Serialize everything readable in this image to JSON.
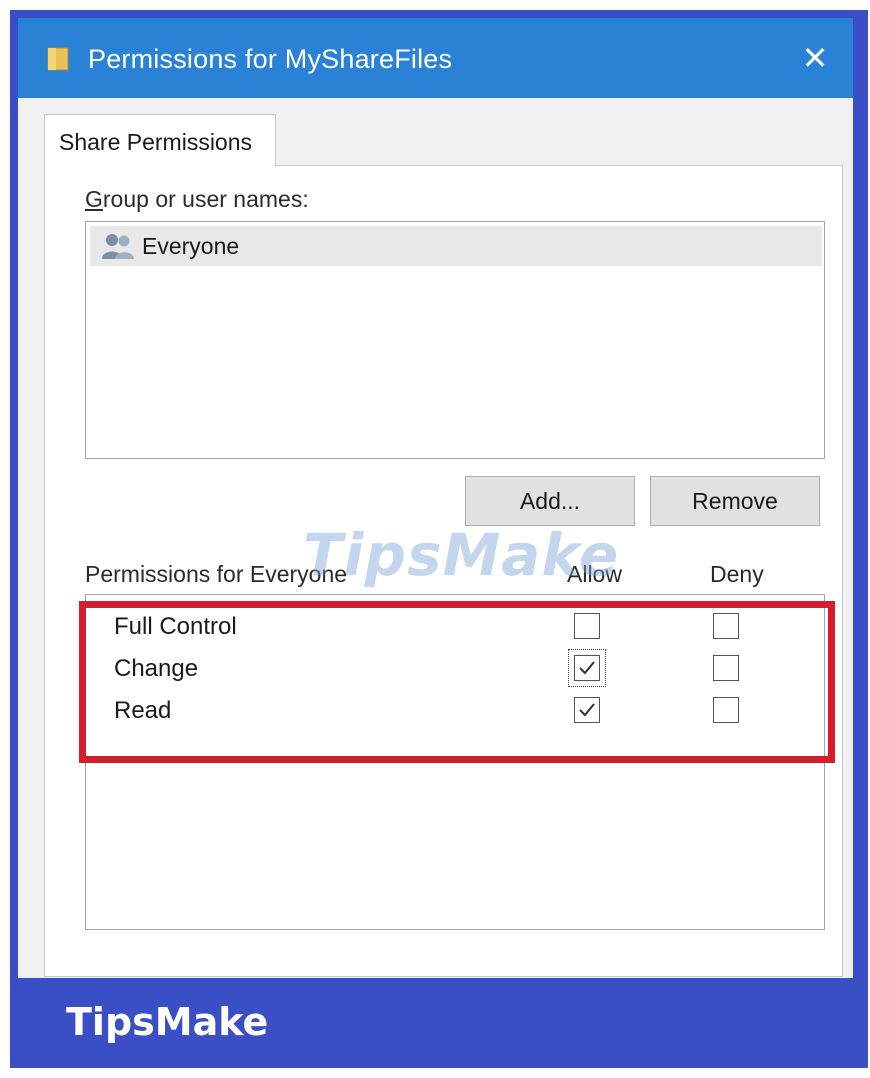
{
  "window": {
    "title": "Permissions for MyShareFiles",
    "close_symbol": "✕",
    "folder_icon": "folder-icon"
  },
  "tab": {
    "label": "Share Permissions"
  },
  "users": {
    "label": "Group or user names:",
    "items": [
      {
        "label": "Everyone",
        "icon": "users-icon"
      }
    ]
  },
  "buttons": {
    "add": "Add...",
    "remove": "Remove"
  },
  "permissions": {
    "header": "Permissions for Everyone",
    "allow_header": "Allow",
    "deny_header": "Deny",
    "rows": [
      {
        "name": "Full Control",
        "allow": false,
        "deny": false
      },
      {
        "name": "Change",
        "allow": true,
        "deny": false
      },
      {
        "name": "Read",
        "allow": true,
        "deny": false
      }
    ]
  },
  "watermark": "TipsMake",
  "footer": {
    "brand": "TipsMake"
  },
  "colors": {
    "titlebar": "#2a82d7",
    "frame": "#3a4fc6",
    "highlight": "#d41e2c"
  }
}
